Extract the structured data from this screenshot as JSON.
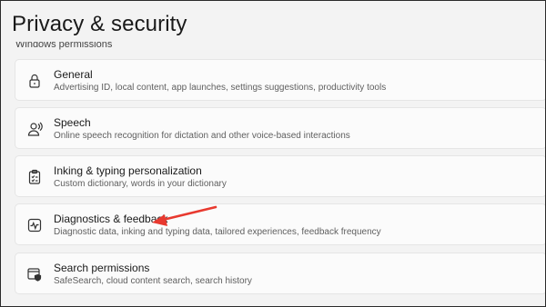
{
  "page": {
    "title": "Privacy & security",
    "section_header": "Windows permissions"
  },
  "items": [
    {
      "title": "General",
      "description": "Advertising ID, local content, app launches, settings suggestions, productivity tools",
      "icon": "lock-icon"
    },
    {
      "title": "Speech",
      "description": "Online speech recognition for dictation and other voice-based interactions",
      "icon": "speech-icon"
    },
    {
      "title": "Inking & typing personalization",
      "description": "Custom dictionary, words in your dictionary",
      "icon": "clipboard-icon"
    },
    {
      "title": "Diagnostics & feedback",
      "description": "Diagnostic data, inking and typing data, tailored experiences, feedback frequency",
      "icon": "diagnostics-icon"
    },
    {
      "title": "Search permissions",
      "description": "SafeSearch, cloud content search, search history",
      "icon": "search-permissions-icon"
    }
  ],
  "annotation": {
    "color": "#e8392f",
    "points_to": "Diagnostics & feedback"
  }
}
